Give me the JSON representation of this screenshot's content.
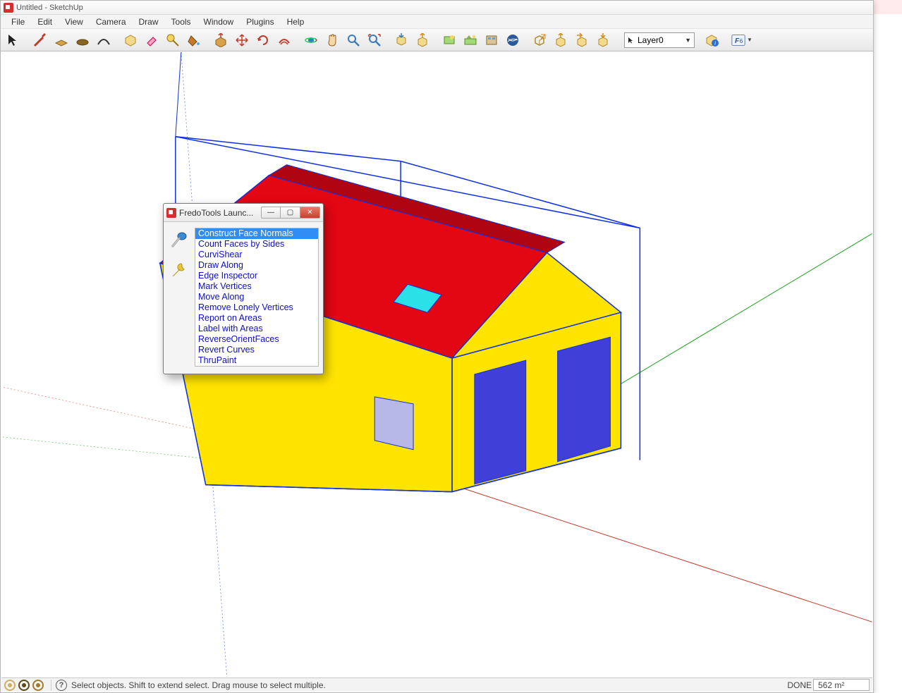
{
  "window": {
    "title": "Untitled - SketchUp"
  },
  "menus": [
    "File",
    "Edit",
    "View",
    "Camera",
    "Draw",
    "Tools",
    "Window",
    "Plugins",
    "Help"
  ],
  "layer": {
    "current": "Layer0"
  },
  "status": {
    "hint": "Select objects. Shift to extend select. Drag mouse to select multiple.",
    "done_label": "DONE",
    "vcb": "562 m²"
  },
  "dialog": {
    "title": "FredoTools Launc...",
    "items": [
      "Construct Face Normals",
      "Count Faces by Sides",
      "CurviShear",
      "Draw Along",
      "Edge Inspector",
      "Mark Vertices",
      "Move Along",
      "Remove Lonely Vertices",
      "Report on Areas",
      "Label with Areas",
      "ReverseOrientFaces",
      "Revert Curves",
      "ThruPaint"
    ],
    "selected_index": 0
  }
}
